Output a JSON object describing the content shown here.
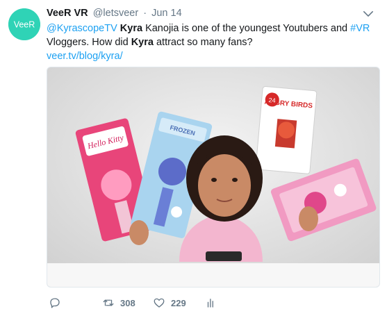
{
  "tweet": {
    "display_name": "VeeR VR",
    "handle": "@letsveer",
    "separator": "·",
    "date": "Jun 14",
    "avatar_text": "VeeR",
    "text": {
      "mention": "@KyrascopeTV",
      "bold_name": "Kyra",
      "part1": " Kanojia is one of the youngest Youtubers and ",
      "hashtag": "#VR",
      "part2": " Vloggers. How did ",
      "bold_name2": "Kyra",
      "part3": " attract so many fans?",
      "url": "veer.tv/blog/kyra/"
    },
    "media_labels": {
      "toy1": "Hello Kitty",
      "toy2": "FROZEN",
      "toy3": "ANGRY BIRDS",
      "badge": "24"
    },
    "actions": {
      "reply_icon": "reply-icon",
      "retweet_icon": "retweet-icon",
      "retweets": "308",
      "like_icon": "heart-icon",
      "likes": "229",
      "stats_icon": "analytics-icon"
    },
    "colors": {
      "accent": "#1da1f2",
      "brand": "#2fd3b6",
      "muted": "#657786"
    }
  }
}
